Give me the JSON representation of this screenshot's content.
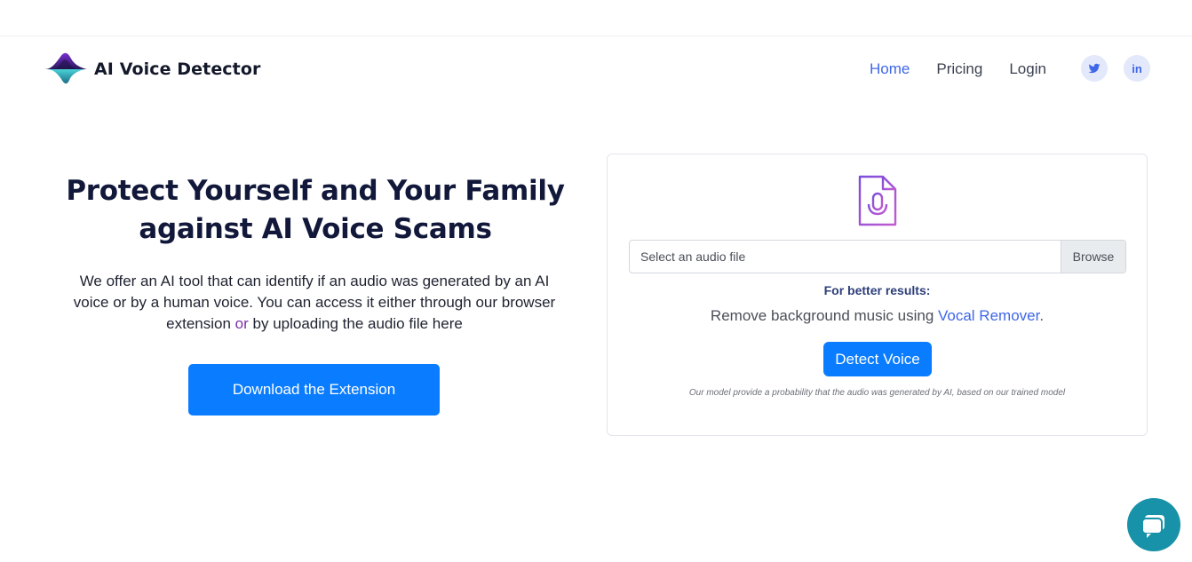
{
  "header": {
    "brand": "AI Voice Detector",
    "nav": [
      {
        "label": "Home",
        "active": true
      },
      {
        "label": "Pricing",
        "active": false
      },
      {
        "label": "Login",
        "active": false
      }
    ],
    "social": [
      {
        "icon": "twitter-icon"
      },
      {
        "icon": "linkedin-icon",
        "label": "in"
      }
    ]
  },
  "hero": {
    "title": "Protect Yourself and Your Family against AI Voice Scams",
    "text_part1": "We offer an AI tool that can identify if an audio was generated by an AI voice or by a human voice. You can access it either through our browser extension ",
    "text_or": "or",
    "text_part2": " by uploading the audio file here",
    "download_button": "Download the Extension"
  },
  "uploader": {
    "file_placeholder": "Select an audio file",
    "browse_label": "Browse",
    "better_results": "For better results:",
    "remove_text": "Remove background music using ",
    "vocal_remover_link": "Vocal Remover",
    "remove_text_end": ".",
    "detect_button": "Detect Voice",
    "disclaimer": "Our model provide a probability that the audio was generated by AI, based on our trained model"
  },
  "colors": {
    "primary": "#0a7cff",
    "link": "#3f67e8",
    "title": "#11183a",
    "chat": "#1792a8"
  }
}
